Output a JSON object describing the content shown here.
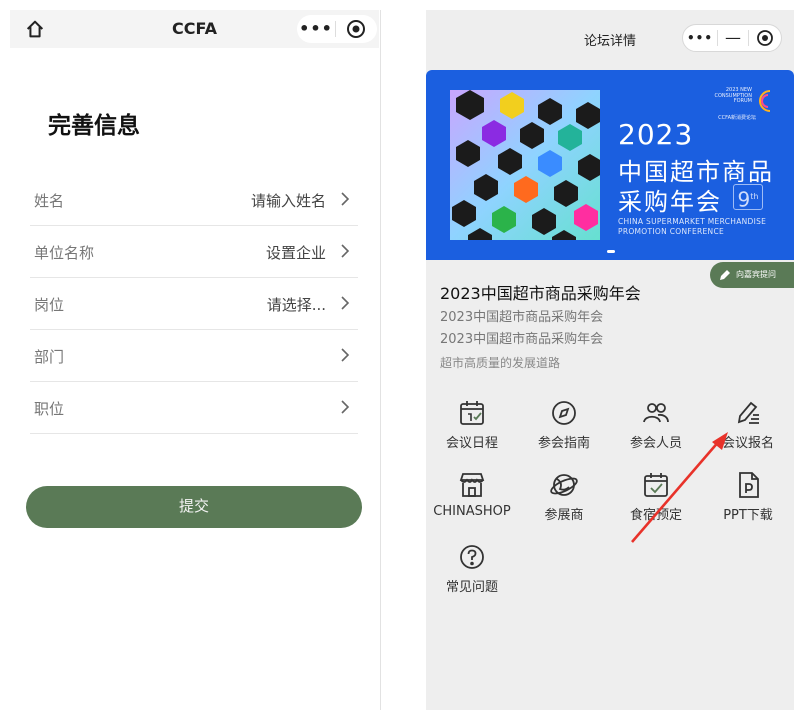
{
  "left": {
    "header": {
      "app_name": "CCFA"
    },
    "page_title": "完善信息",
    "fields": [
      {
        "label": "姓名",
        "value": "请输入姓名"
      },
      {
        "label": "单位名称",
        "value": "设置企业"
      },
      {
        "label": "岗位",
        "value": "请选择..."
      },
      {
        "label": "部门",
        "value": ""
      },
      {
        "label": "职位",
        "value": ""
      }
    ],
    "submit_label": "提交",
    "accent_color": "#5a7a56"
  },
  "right": {
    "header": {
      "title": "论坛详情"
    },
    "banner": {
      "year": "2023",
      "title_line1": "中国超市商品",
      "title_line2": "采购年会",
      "edition": "9",
      "edition_suffix": "th",
      "en_line1": "CHINA SUPERMARKET MERCHANDISE",
      "en_line2": "PROMOTION CONFERENCE",
      "logo_text": "2023 NEW CONSUMPTION FORUM",
      "logo_cn": "CCFA新消费论坛",
      "bg_color": "#1b5fe0"
    },
    "ask_chip": "向嘉宾提问",
    "conference": {
      "title": "2023中国超市商品采购年会",
      "subtitle1": "2023中国超市商品采购年会",
      "subtitle2": "2023中国超市商品采购年会",
      "tagline": "超市高质量的发展道路"
    },
    "menu": [
      {
        "label": "会议日程",
        "icon": "calendar-icon"
      },
      {
        "label": "参会指南",
        "icon": "compass-icon"
      },
      {
        "label": "参会人员",
        "icon": "people-icon"
      },
      {
        "label": "会议报名",
        "icon": "edit-icon"
      },
      {
        "label": "CHINASHOP",
        "icon": "shop-icon"
      },
      {
        "label": "参展商",
        "icon": "globe-icon"
      },
      {
        "label": "食宿预定",
        "icon": "calendar-check-icon"
      },
      {
        "label": "PPT下载",
        "icon": "file-p-icon"
      },
      {
        "label": "常见问题",
        "icon": "question-icon"
      }
    ],
    "annotation_arrow_color": "#e8322a"
  }
}
